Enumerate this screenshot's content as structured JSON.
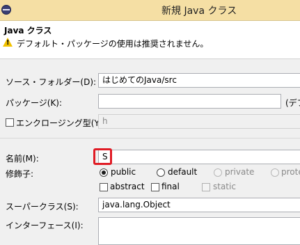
{
  "window": {
    "title": "新規 Java クラス"
  },
  "header": {
    "heading": "Java クラス",
    "warning": "デフォルト・パッケージの使用は推奨されません。"
  },
  "form": {
    "source_folder": {
      "label": "ソース・フォルダー(D):",
      "value": "はじめてのJava/src"
    },
    "package": {
      "label": "パッケージ(K):",
      "value": "",
      "suffix": "(デフ"
    },
    "enclosing": {
      "label": "エンクロージング型(Y):",
      "value": "h"
    },
    "name": {
      "label": "名前(M):",
      "value": "S"
    },
    "modifiers": {
      "label": "修飾子:",
      "radios": [
        "public",
        "default",
        "private",
        "prote"
      ],
      "selected": "public",
      "checks": [
        "abstract",
        "final",
        "static"
      ]
    },
    "superclass": {
      "label": "スーパークラス(S):",
      "value": "java.lang.Object"
    },
    "interfaces": {
      "label": "インターフェース(I):"
    }
  }
}
